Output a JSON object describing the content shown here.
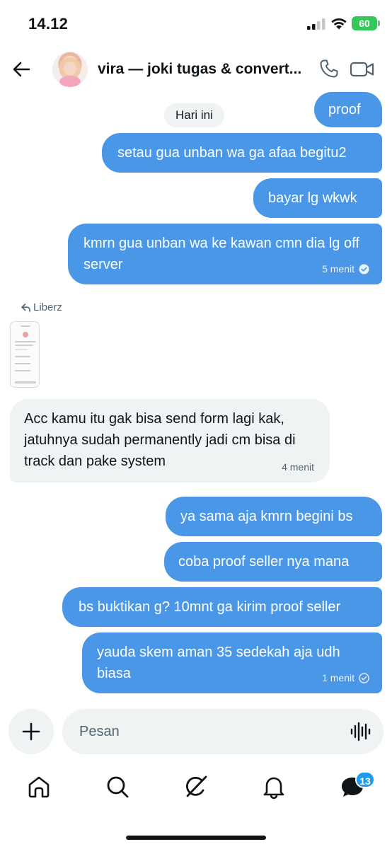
{
  "status_bar": {
    "time": "14.12",
    "battery": "60"
  },
  "header": {
    "contact_name": "vira — joki tugas & convert...",
    "icons": [
      "back-arrow-icon",
      "phone-icon",
      "video-camera-icon"
    ]
  },
  "chat": {
    "date_label": "Hari ini",
    "messages": [
      {
        "direction": "outgoing",
        "text": "proof"
      },
      {
        "direction": "outgoing",
        "text": "setau gua unban wa ga afaa begitu2"
      },
      {
        "direction": "outgoing",
        "text": "bayar lg wkwk"
      },
      {
        "direction": "outgoing",
        "text": "kmrn gua unban wa ke kawan cmn dia lg off server",
        "time": "5 menit"
      },
      {
        "direction": "incoming",
        "reply_to": "Liberz",
        "attachment": "screenshot"
      },
      {
        "direction": "incoming",
        "text": "Acc kamu itu gak bisa send form lagi kak, jatuhnya sudah permanently jadi cm bisa di track dan pake system",
        "time": "4 menit"
      },
      {
        "direction": "outgoing",
        "text": "ya sama aja kmrn begini bs"
      },
      {
        "direction": "outgoing",
        "text": "coba proof seller nya mana"
      },
      {
        "direction": "outgoing",
        "text": "bs buktikan g? 10mnt ga kirim proof seller"
      },
      {
        "direction": "outgoing",
        "text": "yauda skem aman 35 sedekah aja udh biasa",
        "time": "1 menit"
      }
    ]
  },
  "composer": {
    "placeholder": "Pesan",
    "icons": [
      "plus-icon",
      "voice-waveform-icon"
    ]
  },
  "bottom_nav": {
    "items": [
      "home-icon",
      "search-icon",
      "grok-icon",
      "notifications-bell-icon",
      "messages-icon"
    ],
    "messages_badge": "13"
  },
  "colors": {
    "outgoing_bubble": "#4a97e8",
    "incoming_bubble": "#eff3f4",
    "badge": "#1d9bf0",
    "battery": "#34c759"
  }
}
